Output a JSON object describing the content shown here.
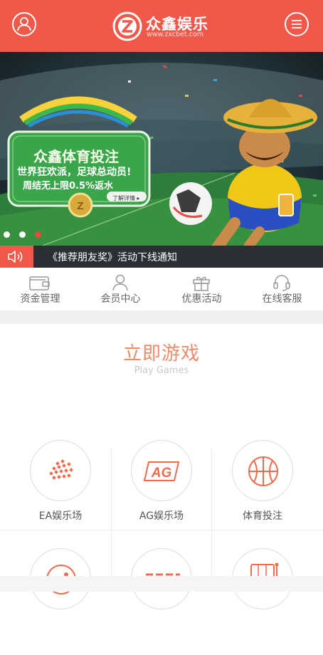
{
  "header": {
    "brand_name": "众鑫娱乐",
    "brand_url": "www.zxcbet.com",
    "logo_letters": "ZX",
    "user_icon": "user-icon",
    "menu_icon": "menu-icon",
    "brand_color": "#f0584a"
  },
  "banner": {
    "promo_title": "众鑫体育投注",
    "promo_line1": "世界狂欢派，足球总动员!",
    "promo_line2": "周结无上限0.5%返水",
    "promo_more": "了解详情 ▸",
    "slide_count": 3
  },
  "notice": {
    "icon": "speaker-icon",
    "text": "《推荐朋友奖》活动下线通知"
  },
  "quicknav": [
    {
      "label": "资金管理",
      "icon": "wallet-icon"
    },
    {
      "label": "会员中心",
      "icon": "member-icon"
    },
    {
      "label": "优惠活动",
      "icon": "gift-icon"
    },
    {
      "label": "在线客服",
      "icon": "headset-icon"
    }
  ],
  "section": {
    "title": "立即游戏",
    "subtitle": "Play Games"
  },
  "games": [
    {
      "label": "EA娱乐场",
      "icon": "ea-icon"
    },
    {
      "label": "AG娱乐场",
      "icon": "ag-icon"
    },
    {
      "label": "体育投注",
      "icon": "basketball-icon"
    },
    {
      "label": "",
      "icon": "game-icon"
    },
    {
      "label": "",
      "icon": "lottery-icon"
    },
    {
      "label": "",
      "icon": "slot-machine-icon"
    }
  ],
  "ag_text": "AG"
}
